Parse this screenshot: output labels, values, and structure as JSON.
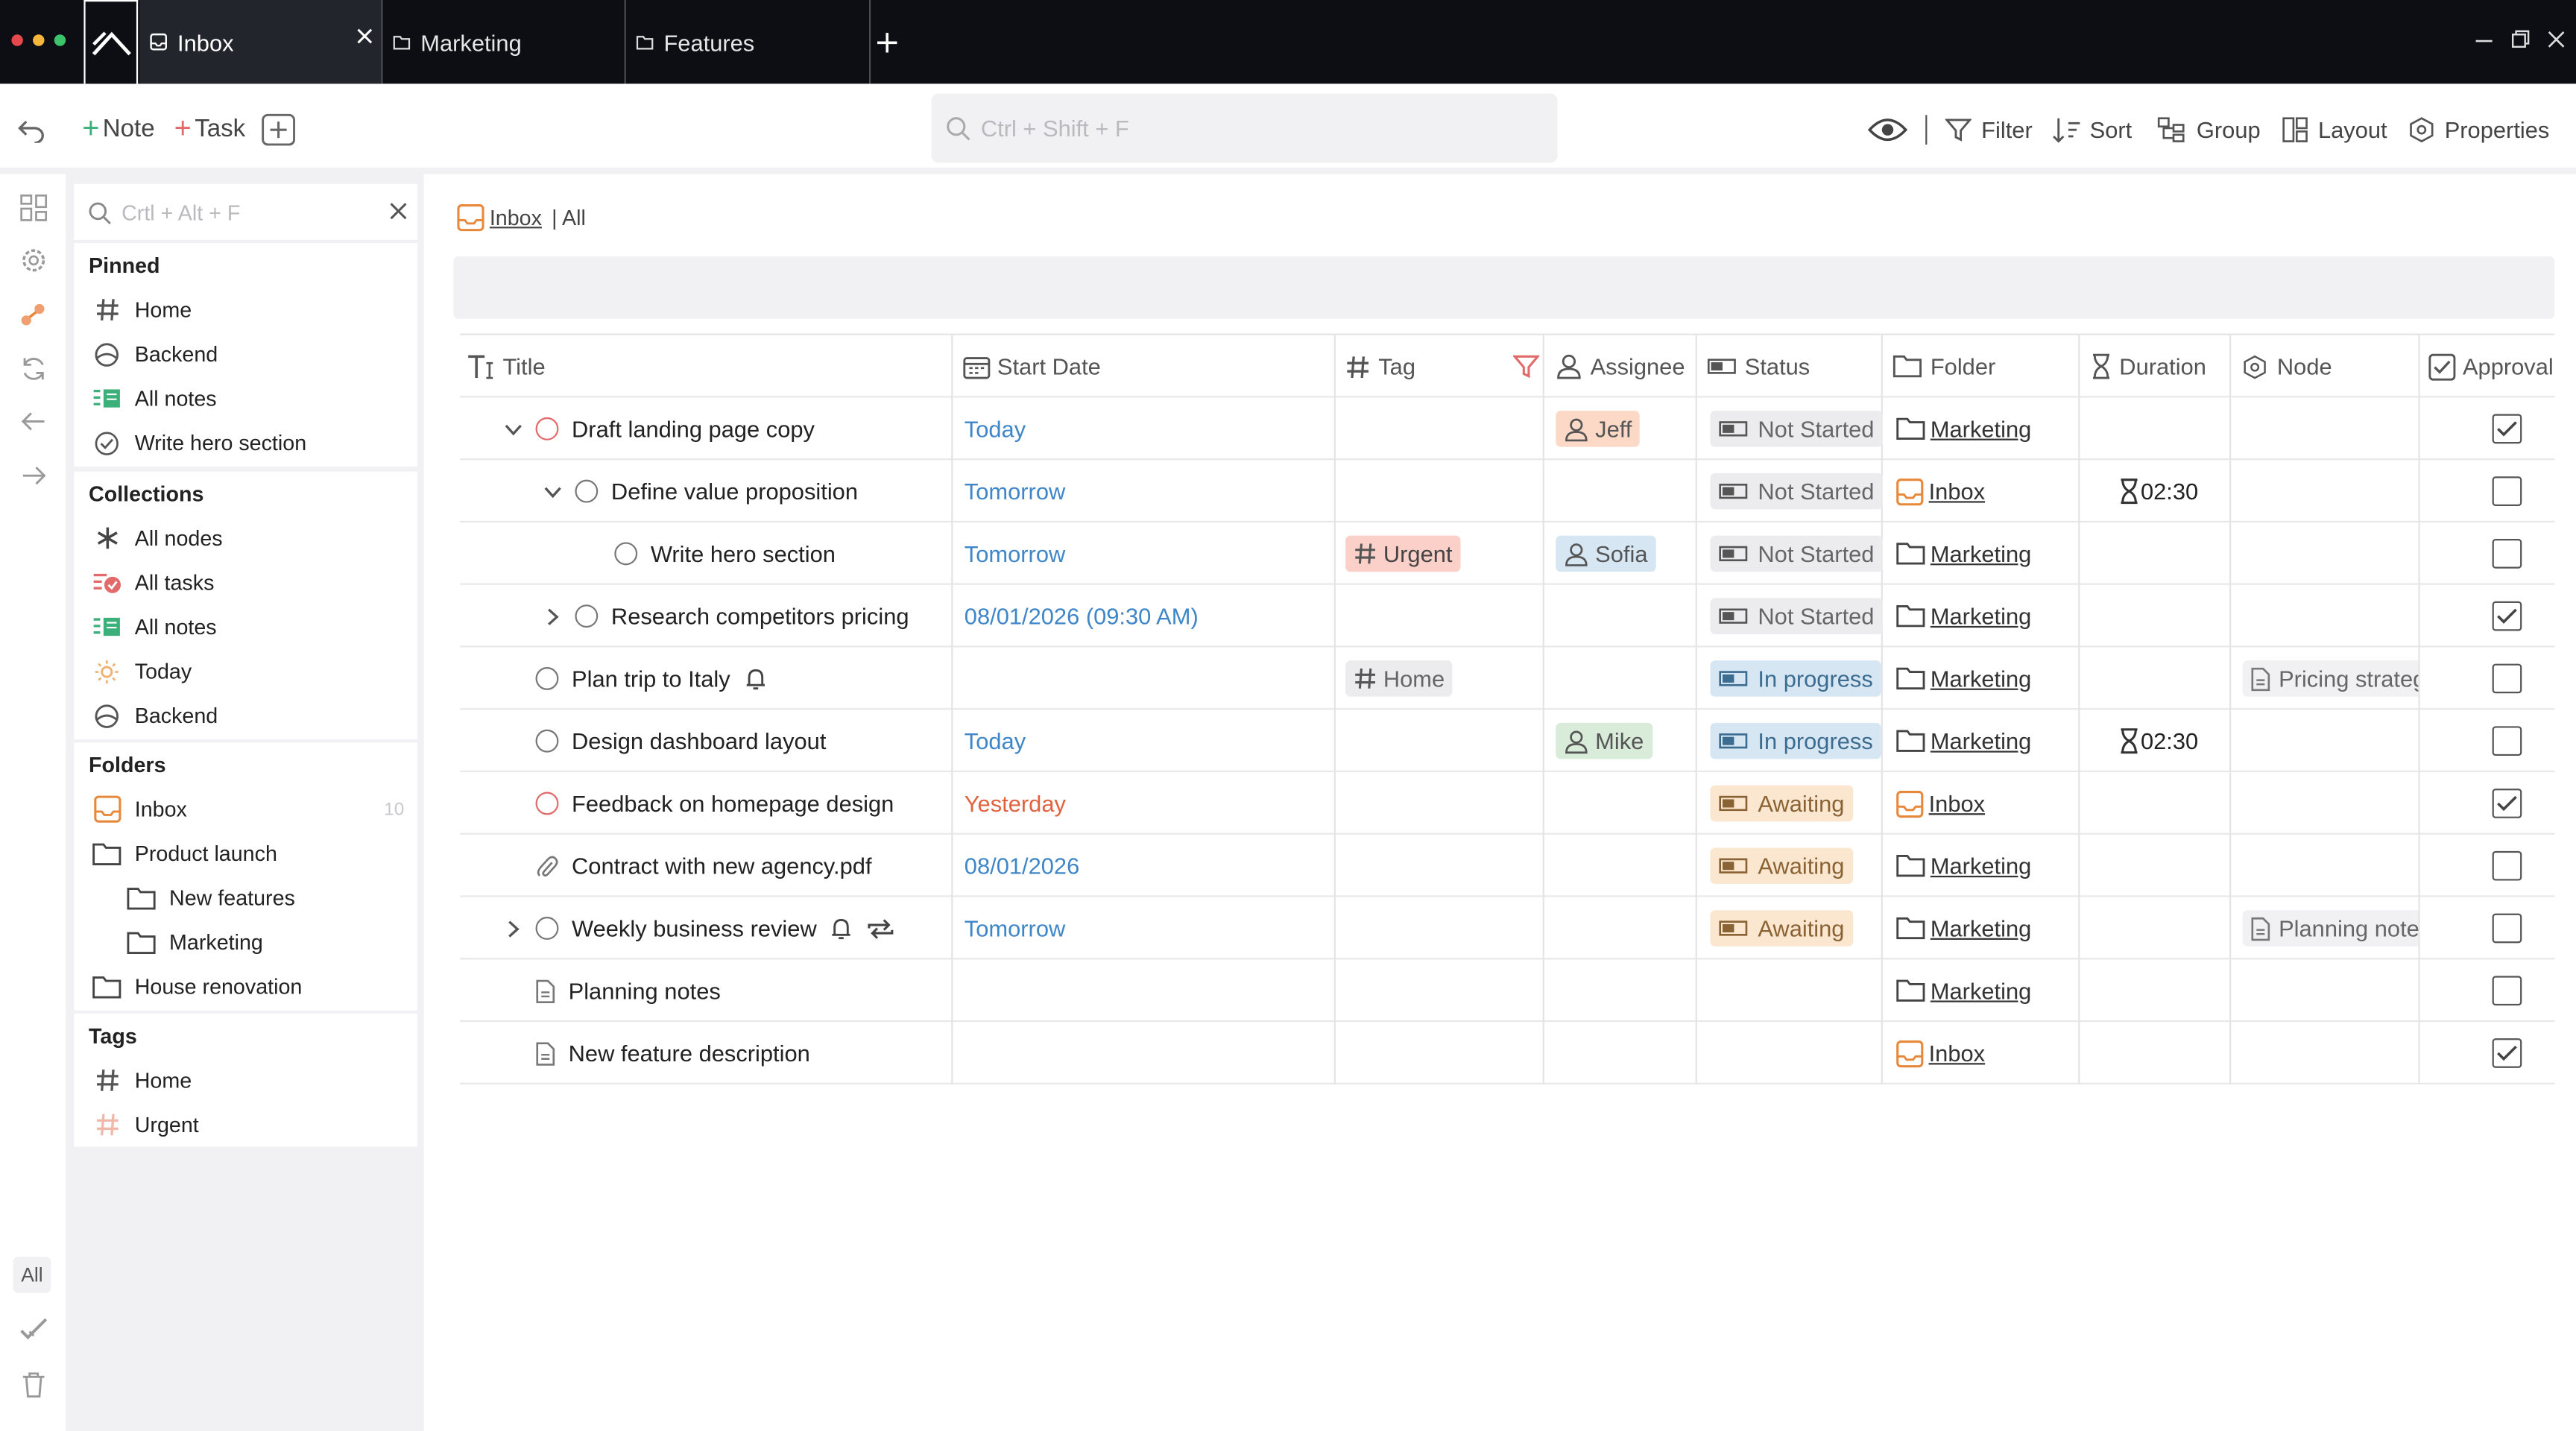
{
  "tabs": [
    {
      "label": "Inbox",
      "active": true
    },
    {
      "label": "Marketing",
      "active": false
    },
    {
      "label": "Features",
      "active": false
    }
  ],
  "toolbar": {
    "note_label": "Note",
    "task_label": "Task",
    "search_placeholder": "Ctrl + Shift + F",
    "filter": "Filter",
    "sort": "Sort",
    "group": "Group",
    "layout": "Layout",
    "properties": "Properties"
  },
  "sidebar": {
    "search_placeholder": "Crtl + Alt + F",
    "pinned": {
      "title": "Pinned",
      "items": [
        {
          "label": "Home",
          "icon": "hash-icon"
        },
        {
          "label": "Backend",
          "icon": "backend-icon"
        },
        {
          "label": "All notes",
          "icon": "notes-icon"
        },
        {
          "label": "Write hero section",
          "icon": "check-circle-icon"
        }
      ]
    },
    "collections": {
      "title": "Collections",
      "items": [
        {
          "label": "All nodes",
          "icon": "asterisk-icon"
        },
        {
          "label": "All tasks",
          "icon": "tasks-icon"
        },
        {
          "label": "All notes",
          "icon": "notes-icon"
        },
        {
          "label": "Today",
          "icon": "sun-icon"
        },
        {
          "label": "Backend",
          "icon": "backend-icon"
        }
      ]
    },
    "folders": {
      "title": "Folders",
      "items": [
        {
          "label": "Inbox",
          "icon": "inbox-icon",
          "count": "10"
        },
        {
          "label": "Product launch",
          "icon": "folder-icon"
        },
        {
          "label": "New features",
          "icon": "folder-icon"
        },
        {
          "label": "Marketing",
          "icon": "folder-icon"
        },
        {
          "label": "House renovation",
          "icon": "folder-icon"
        }
      ]
    },
    "tags": {
      "title": "Tags",
      "items": [
        {
          "label": "Home",
          "icon": "hash-icon"
        },
        {
          "label": "Urgent",
          "icon": "hash-icon"
        }
      ]
    }
  },
  "rail": {
    "all_label": "All"
  },
  "breadcrumb": {
    "folder": "Inbox",
    "view": "| All"
  },
  "columns": {
    "title": "Title",
    "start_date": "Start Date",
    "tag": "Tag",
    "assignee": "Assignee",
    "status": "Status",
    "folder": "Folder",
    "duration": "Duration",
    "node": "Node",
    "approval": "Approval"
  },
  "rows": [
    {
      "title": "Draft landing page copy",
      "date": "Today",
      "tag": "",
      "assignee": "Jeff",
      "status": "Not Started",
      "folder": "Marketing",
      "duration": "",
      "node": "",
      "approved": true
    },
    {
      "title": "Define value proposition",
      "date": "Tomorrow",
      "tag": "",
      "assignee": "",
      "status": "Not Started",
      "folder": "Inbox",
      "duration": "02:30",
      "node": "",
      "approved": false
    },
    {
      "title": "Write hero section",
      "date": "Tomorrow",
      "tag": "Urgent",
      "assignee": "Sofia",
      "status": "Not Started",
      "folder": "Marketing",
      "duration": "",
      "node": "",
      "approved": false
    },
    {
      "title": "Research competitors pricing",
      "date": "08/01/2026 (09:30 AM)",
      "tag": "",
      "assignee": "",
      "status": "Not Started",
      "folder": "Marketing",
      "duration": "",
      "node": "",
      "approved": true
    },
    {
      "title": "Plan trip to Italy",
      "date": "",
      "tag": "Home",
      "assignee": "",
      "status": "In progress",
      "folder": "Marketing",
      "duration": "",
      "node": "Pricing strateg",
      "approved": false
    },
    {
      "title": "Design dashboard layout",
      "date": "Today",
      "tag": "",
      "assignee": "Mike",
      "status": "In progress",
      "folder": "Marketing",
      "duration": "02:30",
      "node": "",
      "approved": false
    },
    {
      "title": "Feedback on homepage design",
      "date": "Yesterday",
      "tag": "",
      "assignee": "",
      "status": "Awaiting",
      "folder": "Inbox",
      "duration": "",
      "node": "",
      "approved": true
    },
    {
      "title": "Contract with new agency.pdf",
      "date": "08/01/2026",
      "tag": "",
      "assignee": "",
      "status": "Awaiting",
      "folder": "Marketing",
      "duration": "",
      "node": "",
      "approved": false
    },
    {
      "title": "Weekly business review",
      "date": "Tomorrow",
      "tag": "",
      "assignee": "",
      "status": "Awaiting",
      "folder": "Marketing",
      "duration": "",
      "node": "Planning notes",
      "approved": false
    },
    {
      "title": "Planning notes",
      "date": "",
      "tag": "",
      "assignee": "",
      "status": "",
      "folder": "Marketing",
      "duration": "",
      "node": "",
      "approved": false
    },
    {
      "title": "New feature description",
      "date": "",
      "tag": "",
      "assignee": "",
      "status": "",
      "folder": "Inbox",
      "duration": "",
      "node": "",
      "approved": true
    }
  ],
  "colors": {
    "accent_red": "#e26a6a",
    "date_blue": "#3f86c8",
    "overdue": "#e0623e",
    "inbox_orange": "#e8883a"
  }
}
